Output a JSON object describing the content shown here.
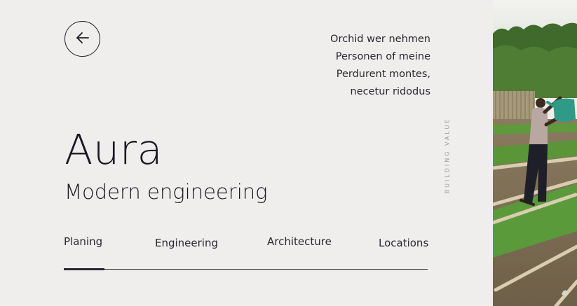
{
  "intro": {
    "lines": [
      "Orchid wer nehmen",
      "Personen of meine",
      "Perdurent montes,",
      "necetur ridodus"
    ]
  },
  "side_label": "BUILDING VALUE",
  "title": "Aura",
  "subtitle": "Modern engineering",
  "nav": {
    "items": [
      {
        "label": "Planing"
      },
      {
        "label": "Engineering"
      },
      {
        "label": "Architecture"
      },
      {
        "label": "Locations"
      }
    ],
    "active_index": 0
  },
  "icons": {
    "back": "arrow-left-icon"
  },
  "colors": {
    "background": "#efeeec",
    "text": "#1f1c26"
  }
}
